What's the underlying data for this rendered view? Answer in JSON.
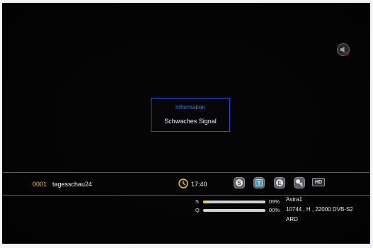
{
  "dialog": {
    "title": "Information",
    "message": "Schwaches Signal"
  },
  "infobar": {
    "channel_number": "0001",
    "channel_name": "tagesschau24",
    "time": "17:40",
    "hd_label": "HD",
    "service_icons": [
      "subtitle-icon",
      "teletext-icon",
      "epg-icon",
      "key-icon"
    ],
    "signal": {
      "label": "S",
      "value": "09%",
      "fraction": 0.09
    },
    "quality": {
      "label": "Q",
      "value": "00%",
      "fraction": 0.0
    },
    "satellite": "Astra1",
    "transponder": "10744 , H , 22000 DVB-S2",
    "provider": "ARD"
  },
  "colors": {
    "accent_blue": "#2b4fd8",
    "channel_number": "#f0c53a",
    "meter_fill": "#f2d23a"
  }
}
